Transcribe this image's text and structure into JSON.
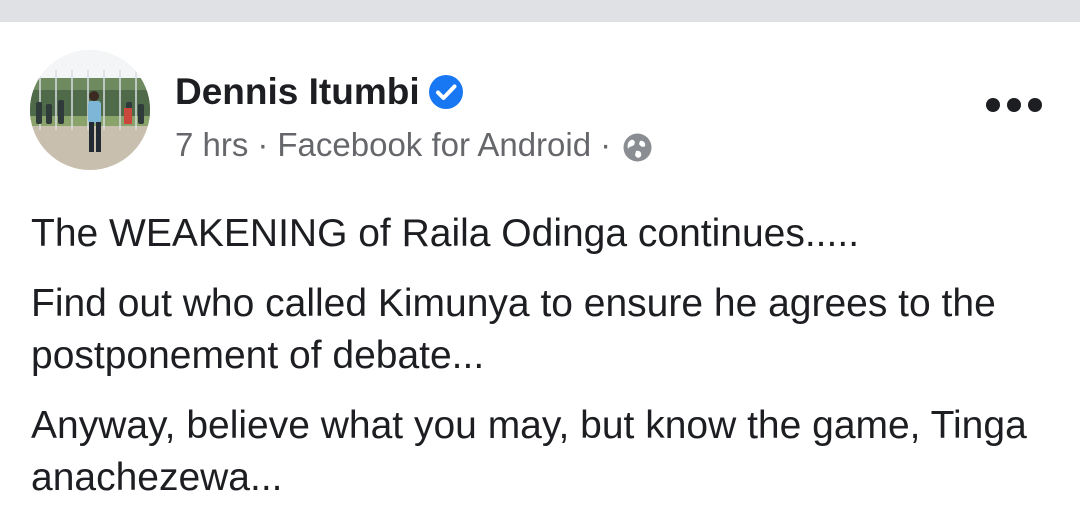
{
  "post": {
    "author": "Dennis Itumbi",
    "verified_icon": "verified-badge-icon",
    "time": "7 hrs",
    "separator": "·",
    "source": "Facebook for Android",
    "privacy_icon": "globe-icon",
    "more_icon": "more-options-icon",
    "paragraphs": [
      "The WEAKENING of Raila Odinga continues.....",
      "Find out who called Kimunya to ensure he agrees to the postponement of debate...",
      "Anyway, believe what you may, but know the game, Tinga anachezewa..."
    ]
  },
  "colors": {
    "verified_blue": "#1877f2",
    "text_primary": "#1c1e21",
    "text_secondary": "#65676b",
    "top_strip": "#dfe1e5"
  }
}
